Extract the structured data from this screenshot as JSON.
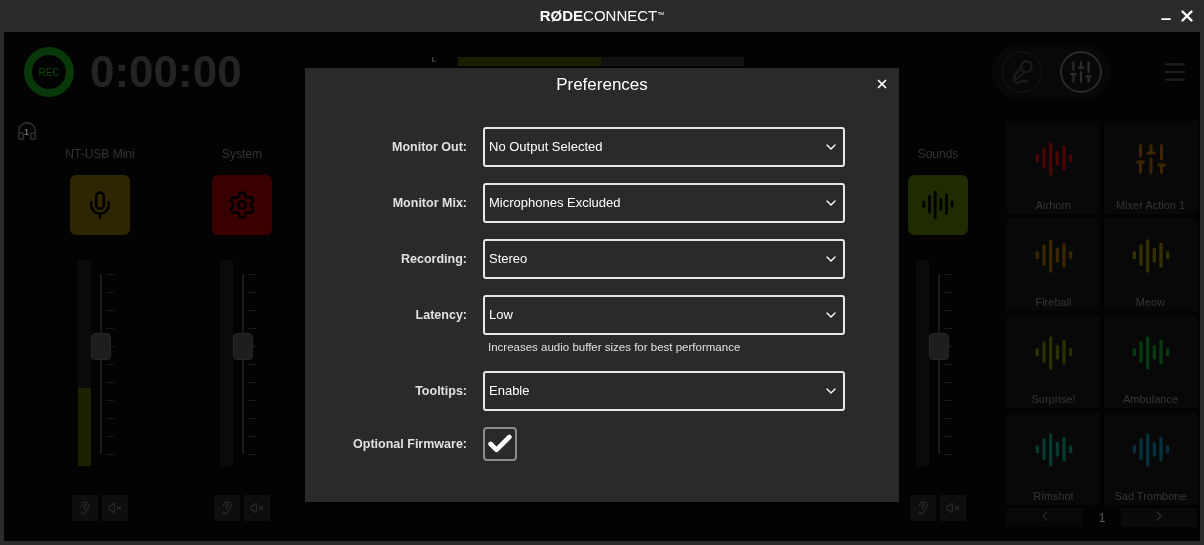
{
  "title_bar": {
    "brand": "RØDE",
    "product": "CONNECT",
    "mark": "™"
  },
  "header": {
    "rec": "REC",
    "timer": "0:00:00",
    "meter_label": "L",
    "meter": {
      "level": 0.5
    }
  },
  "mode_switch": [
    {
      "kind": "microphones",
      "selected": false
    },
    {
      "kind": "mixer",
      "selected": true
    }
  ],
  "monitor": {
    "number": "1"
  },
  "channels": [
    {
      "name": "NT-USB Mini",
      "kind": "mic",
      "color": "#2e2600",
      "meter": {
        "level": 0.38
      },
      "fader": {
        "level": 0.6
      }
    },
    {
      "name": "System",
      "kind": "system",
      "color": "#3a0000",
      "fader": {
        "level": 0.6
      }
    },
    {
      "name": "Sounds",
      "kind": "sounds",
      "color": "#1f2b00",
      "fader": {
        "level": 0.6
      }
    }
  ],
  "pads": [
    {
      "name": "Airhorn",
      "kind": "wave",
      "color": "#4a0606"
    },
    {
      "name": "Mixer Action 1",
      "kind": "sliders",
      "color": "#3e2400"
    },
    {
      "name": "Fireball",
      "kind": "wave",
      "color": "#3a2600"
    },
    {
      "name": "Meow",
      "kind": "wave",
      "color": "#363000"
    },
    {
      "name": "Surprise!",
      "kind": "wave",
      "color": "#263200"
    },
    {
      "name": "Ambulance",
      "kind": "wave",
      "color": "#063a10"
    },
    {
      "name": "Rimshot",
      "kind": "wave",
      "color": "#063a2e"
    },
    {
      "name": "Sad Trombone",
      "kind": "wave",
      "color": "#06303e"
    }
  ],
  "pager": {
    "page": "1"
  },
  "dialog": {
    "title": "Preferences",
    "fields": [
      {
        "label": "Monitor Out:",
        "kind": "select",
        "value": "No Output Selected"
      },
      {
        "label": "Monitor Mix:",
        "kind": "select",
        "value": "Microphones Excluded"
      },
      {
        "label": "Recording:",
        "kind": "select",
        "value": "Stereo"
      },
      {
        "label": "Latency:",
        "kind": "select",
        "value": "Low",
        "hint": "Increases audio buffer sizes for best performance"
      },
      {
        "label": "Tooltips:",
        "kind": "select",
        "value": "Enable"
      },
      {
        "label": "Optional Firmware:",
        "kind": "checkbox",
        "checked": true
      }
    ]
  }
}
